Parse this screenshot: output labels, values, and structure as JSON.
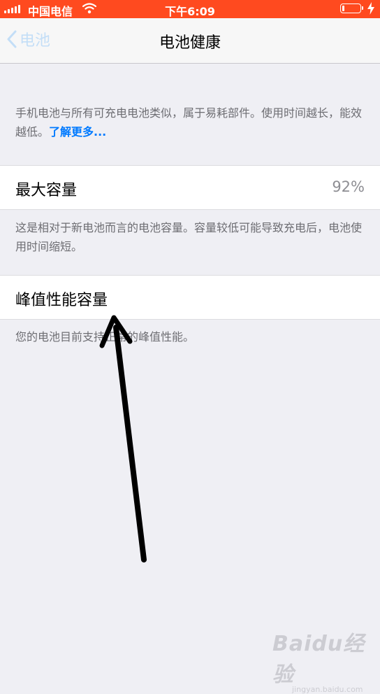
{
  "status_bar": {
    "carrier": "中国电信",
    "time": "下午6:09",
    "battery_level": 0.15,
    "color": "#ff4a1f"
  },
  "nav": {
    "back_label": "电池",
    "title": "电池健康"
  },
  "intro": {
    "text": "手机电池与所有可充电电池类似，属于易耗部件。使用时间越长，能效越低。",
    "link": "了解更多..."
  },
  "max_capacity": {
    "label": "最大容量",
    "value": "92%",
    "description": "这是相对于新电池而言的电池容量。容量较低可能导致充电后，电池使用时间缩短。"
  },
  "peak_performance": {
    "label": "峰值性能容量",
    "description": "您的电池目前支持正常的峰值性能。"
  },
  "watermark": {
    "brand": "Baidu经验",
    "url": "jingyan.baidu.com"
  },
  "colors": {
    "accent": "#007aff",
    "background": "#efeff4",
    "annotation_arrow": "#000000"
  },
  "icons": [
    "signal-icon",
    "wifi-icon",
    "battery-icon",
    "charging-bolt-icon",
    "chevron-left-icon",
    "annotation-arrow"
  ]
}
